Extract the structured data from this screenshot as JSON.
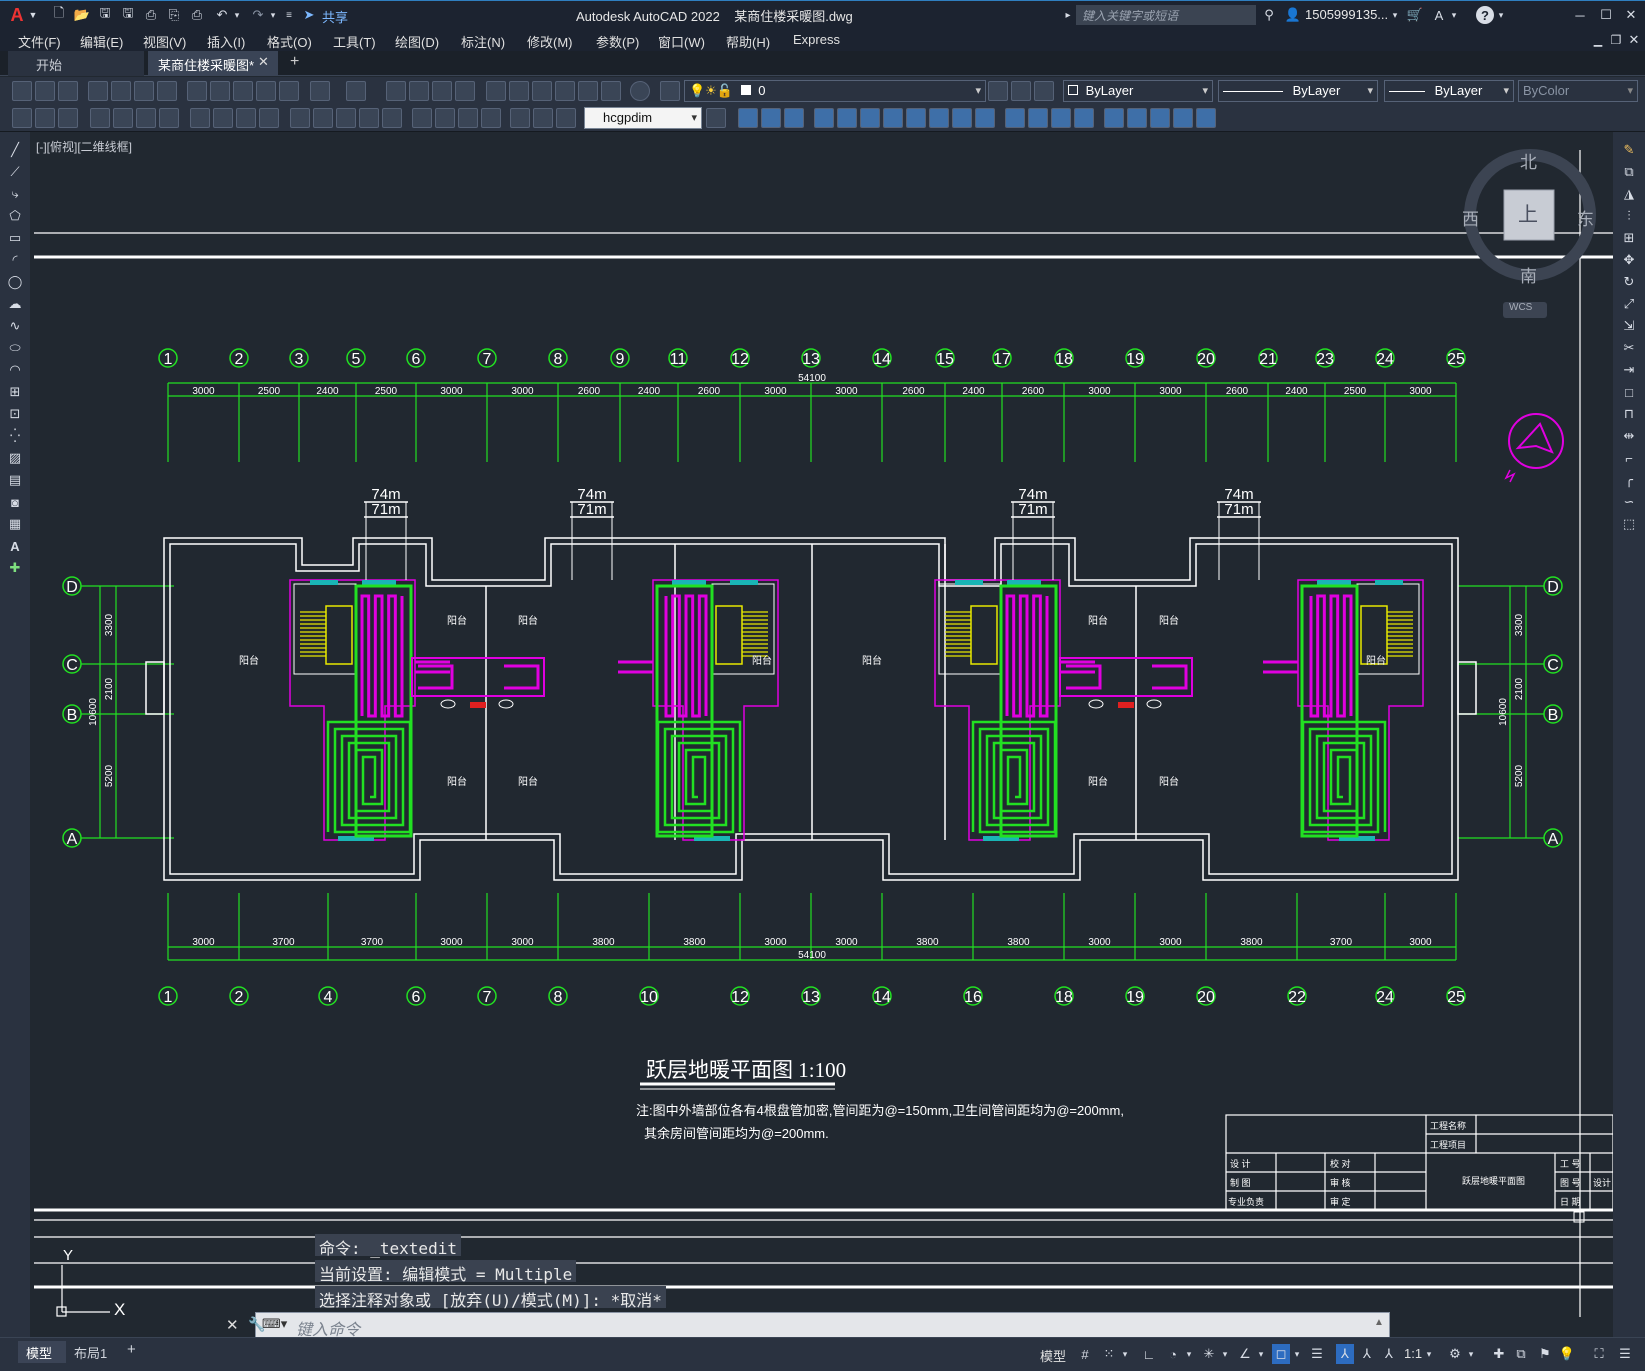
{
  "titlebar": {
    "app_logo": "A",
    "share_label": "共享",
    "title": "Autodesk AutoCAD 2022    某商住楼采暖图.dwg",
    "search_placeholder": "键入关键字或短语",
    "user": "1505999135...",
    "help": "?"
  },
  "menu": [
    "文件(F)",
    "编辑(E)",
    "视图(V)",
    "插入(I)",
    "格式(O)",
    "工具(T)",
    "绘图(D)",
    "标注(N)",
    "修改(M)",
    "参数(P)",
    "窗口(W)",
    "帮助(H)",
    "Express"
  ],
  "tabs": {
    "start": "开始",
    "doc": "某商住楼采暖图*",
    "add": "+"
  },
  "toolbar": {
    "layer_value": "0",
    "color_value": "ByLayer",
    "linetype_value": "ByLayer",
    "lineweight_value": "ByLayer",
    "plotstyle_value": "ByColor",
    "dimstyle_value": "hcgpdim"
  },
  "viewport_label": "[-][俯视][二维线框]",
  "viewcube": {
    "north": "北",
    "south": "南",
    "east": "东",
    "west": "西",
    "top": "上",
    "wcs": "WCS"
  },
  "plan": {
    "top_axes": [
      "1",
      "2",
      "3",
      "5",
      "6",
      "7",
      "8",
      "9",
      "11",
      "12",
      "13",
      "14",
      "15",
      "17",
      "18",
      "19",
      "20",
      "21",
      "23",
      "24",
      "25"
    ],
    "top_dims": [
      "3000",
      "2500",
      "2400",
      "2500",
      "3000",
      "3000",
      "2600",
      "2400",
      "2600",
      "3000",
      "3000",
      "2600",
      "2400",
      "2600",
      "3000",
      "3000",
      "2600",
      "2400",
      "2500",
      "3000"
    ],
    "bottom_axes": [
      "1",
      "2",
      "4",
      "6",
      "7",
      "8",
      "10",
      "12",
      "13",
      "14",
      "16",
      "18",
      "19",
      "20",
      "22",
      "24",
      "25"
    ],
    "bottom_dims": [
      "3000",
      "3700",
      "3700",
      "3000",
      "3000",
      "3800",
      "3800",
      "3000",
      "3000",
      "3800",
      "3800",
      "3000",
      "3000",
      "3800",
      "3700",
      "3000"
    ],
    "total_dim": "54100",
    "row_axes": [
      "D",
      "C",
      "B",
      "A"
    ],
    "side_dims": [
      "3300",
      "2100",
      "5200"
    ],
    "side_total": "10600",
    "pipe_top": "74m",
    "pipe_bottom": "71m",
    "room_label": "阳台",
    "title": "跃层地暖平面图 1:100",
    "note1": "注:图中外墙部位各有4根盘管加密,管间距为@=150mm,卫生间管间距均为@=200mm,",
    "note2": "其余房间管间距均为@=200mm."
  },
  "titleblock": {
    "project_name": "工程名称",
    "project_item": "工程项目",
    "design": "设 计",
    "draw": "制 图",
    "lead": "专业负责",
    "check": "校 对",
    "review": "审 核",
    "approve": "审 定",
    "drawing_name": "跃层地暖平面图",
    "work_no": "工 号",
    "sheet_no": "图 号",
    "date": "日 期",
    "design_stage": "设计"
  },
  "command": {
    "line1": "命令: _textedit",
    "line2": "当前设置: 编辑模式 = Multiple",
    "line3": "选择注释对象或 [放弃(U)/模式(M)]: *取消*",
    "placeholder": "键入命令"
  },
  "ucs": {
    "x": "X",
    "y": "Y"
  },
  "status": {
    "model_tab": "模型",
    "layout_tab": "布局1",
    "add": "+",
    "model_btn": "模型",
    "scale": "1:1"
  }
}
